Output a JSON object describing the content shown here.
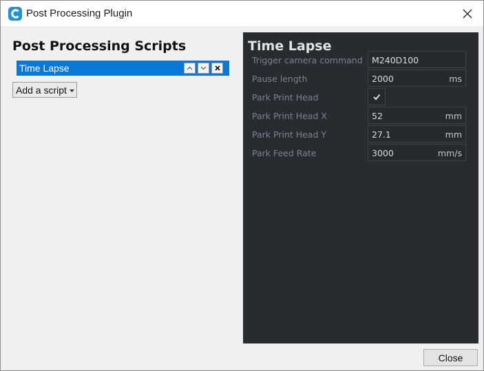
{
  "window": {
    "title": "Post Processing Plugin",
    "icon": "cura-logo-icon",
    "accent": "#0a78d7"
  },
  "left": {
    "heading": "Post Processing Scripts",
    "scripts": [
      {
        "label": "Time Lapse",
        "selected": true
      }
    ],
    "add_button": "Add a script"
  },
  "panel": {
    "title": "Time Lapse",
    "fields": [
      {
        "label": "Trigger camera command",
        "value": "M240D100",
        "unit": ""
      },
      {
        "label": "Pause length",
        "value": "2000",
        "unit": "ms"
      },
      {
        "label": "Park Print Head",
        "checked": true
      },
      {
        "label": "Park Print Head X",
        "value": "52",
        "unit": "mm"
      },
      {
        "label": "Park Print Head Y",
        "value": "27.1",
        "unit": "mm"
      },
      {
        "label": "Park Feed Rate",
        "value": "3000",
        "unit": "mm/s"
      }
    ]
  },
  "footer": {
    "close_button": "Close"
  }
}
